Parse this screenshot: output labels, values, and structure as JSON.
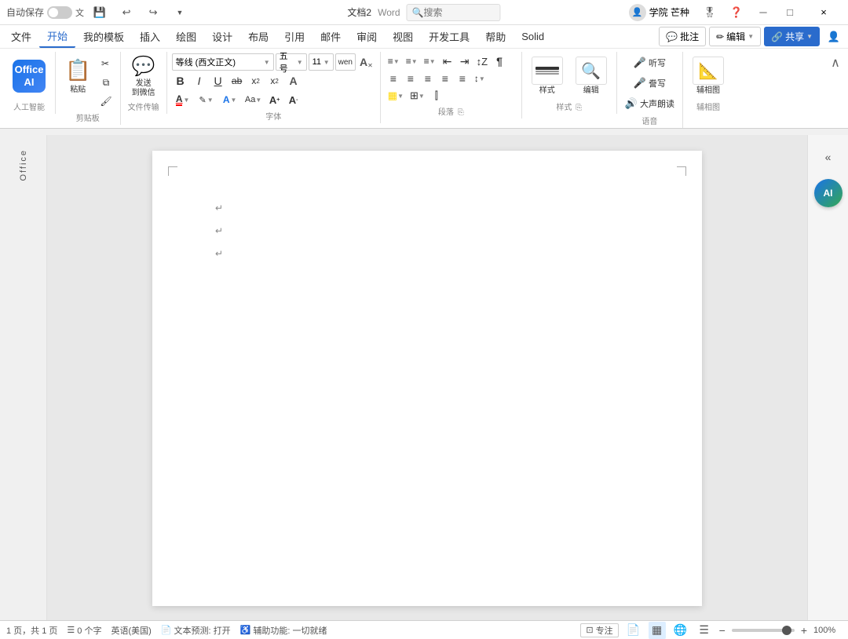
{
  "titlebar": {
    "autosave_label": "自动保存",
    "filename": "文档2",
    "app_name": "Word",
    "undo_label": "撤销",
    "redo_label": "重做",
    "search_placeholder": "搜索",
    "username": "学院 芒种",
    "minimize_label": "─",
    "maximize_label": "□",
    "close_label": "×"
  },
  "menu": {
    "items": [
      {
        "id": "file",
        "label": "文件"
      },
      {
        "id": "home",
        "label": "开始",
        "active": true
      },
      {
        "id": "template",
        "label": "我的模板"
      },
      {
        "id": "insert",
        "label": "插入"
      },
      {
        "id": "draw",
        "label": "绘图"
      },
      {
        "id": "design",
        "label": "设计"
      },
      {
        "id": "layout",
        "label": "布局"
      },
      {
        "id": "reference",
        "label": "引用"
      },
      {
        "id": "mail",
        "label": "邮件"
      },
      {
        "id": "review",
        "label": "审阅"
      },
      {
        "id": "view",
        "label": "视图"
      },
      {
        "id": "devtools",
        "label": "开发工具"
      },
      {
        "id": "help",
        "label": "帮助"
      },
      {
        "id": "solid",
        "label": "Solid"
      }
    ]
  },
  "ribbon": {
    "ai_group": {
      "label": "人工智能",
      "office_ai": "Office\nAI"
    },
    "clipboard_group": {
      "label": "剪贴板",
      "paste": "粘贴",
      "cut_icon": "✂",
      "copy_icon": "⧉",
      "format_painter_icon": "🖌"
    },
    "file_transfer_group": {
      "label": "文件传输",
      "send_to_wechat": "发送\n到微信",
      "send_icon": "💬"
    },
    "font_group": {
      "label": "字体",
      "font_name": "等线 (西文正文)",
      "font_size": "五号",
      "font_size_num": "11",
      "bold": "B",
      "italic": "I",
      "underline": "U",
      "strikethrough": "abc",
      "subscript": "x₂",
      "superscript": "x²",
      "clear_format": "A",
      "grow_font": "A↑",
      "shrink_font": "A↓",
      "change_case": "Aa",
      "font_color": "A",
      "highlight": "✎",
      "text_effect": "A"
    },
    "paragraph_group": {
      "label": "段落",
      "bullets": "≡",
      "numbering": "≡",
      "multilevel": "≡",
      "indent_decrease": "←",
      "indent_increase": "→",
      "align_left": "≡",
      "align_center": "≡",
      "align_right": "≡",
      "justify": "≡",
      "distributed": "≡",
      "line_spacing": "↕",
      "sort": "↕",
      "show_marks": "¶",
      "shading": "▦",
      "border": "⊞",
      "column": "|||"
    },
    "styles_group": {
      "label": "样式",
      "btn_label": "样式"
    },
    "editing_group": {
      "label": "编辑",
      "btn_label": "编辑",
      "find": "🔍"
    },
    "dictate_group": {
      "label": "语音",
      "listen": "听写",
      "listen_icon": "🎤",
      "compose": "誊写",
      "compose_icon": "🎤",
      "read_aloud": "大声朗读",
      "read_icon": "🔊"
    },
    "smart_group": {
      "label": "辅相图",
      "btn_label": "辅相图"
    },
    "review_btn": "批注",
    "edit_btn": "编辑",
    "share_btn": "共享"
  },
  "statusbar": {
    "page_info": "1 页，共 1 页",
    "word_count": "0 个字",
    "language": "英语(美国)",
    "text_prediction": "文本预测: 打开",
    "accessibility": "辅助功能: 一切就绪",
    "focus": "专注",
    "zoom": "100%"
  },
  "page": {
    "paragraphs": [
      "↵",
      "↵",
      "↵"
    ]
  },
  "right_sidebar": {
    "collapse_icon": "«",
    "ai_label": "AI"
  }
}
